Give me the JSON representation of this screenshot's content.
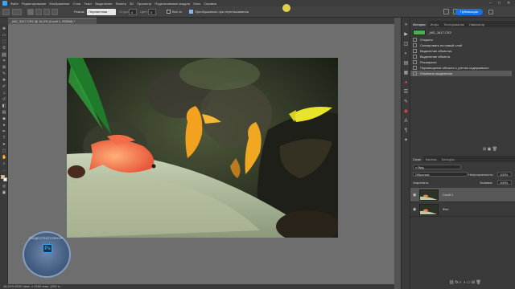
{
  "menubar": {
    "items": [
      "Файл",
      "Редактирование",
      "Изображение",
      "Слои",
      "Текст",
      "Выделение",
      "Фильтр",
      "3D",
      "Просмотр",
      "Подключаемые модули",
      "Окно",
      "Справка"
    ]
  },
  "options": {
    "mode_label": "Режим:",
    "mode_value": "Переменная",
    "structure_label": "Структура:",
    "structure_value": "4",
    "color_label": "Цвет:",
    "color_value": "0",
    "all_layers_label": "Все сл",
    "transform_label": "Преобразовать при перетаскивании",
    "share_label": "Публикация"
  },
  "document": {
    "tab_title": "_MG_3417.CR2 @ 16,2% (Слой 1, RGB/8) *",
    "status": "16,24%    6240 пикс. x 4160 пикс. (300 п..."
  },
  "watermark": {
    "ps_text": "Ps",
    "arc_text": "РАЗДЕЛ PHOTOSHOP"
  },
  "history": {
    "tabs": [
      "История",
      "Инфо",
      "Тестирование",
      "Навигатор"
    ],
    "snapshot": "_MG_3417.CR2",
    "items": [
      "Открыть",
      "Скопировать на новый слой",
      "Выделение объектов",
      "Выделение объекта",
      "Расширить",
      "Перемещение области с учетом содержимого",
      "Отменить выделение"
    ],
    "selected_index": 6
  },
  "layers": {
    "tabs": [
      "Слои",
      "Каналы",
      "Контуры"
    ],
    "filter_label": "Вид",
    "blend_mode": "Обычные",
    "opacity_label": "Непрозрачность:",
    "opacity_value": "100%",
    "lock_label": "Закрепить:",
    "fill_label": "Заливка:",
    "fill_value": "100%",
    "items": [
      {
        "name": "Слой 1",
        "selected": true
      },
      {
        "name": "Фон",
        "selected": false
      }
    ]
  },
  "colors": {
    "accent": "#1473e6",
    "cursor": "#f4e04d",
    "canvas_bg": "#6e6e6e"
  },
  "icons": [
    "photoshop-logo",
    "move-tool-icon",
    "marquee-tool-icon",
    "lasso-tool-icon",
    "crop-tool-icon",
    "brush-tool-icon",
    "eye-icon",
    "history-icon",
    "layers-icon"
  ]
}
